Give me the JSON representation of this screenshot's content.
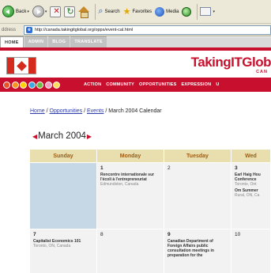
{
  "browser": {
    "back_label": "Back",
    "search_label": "Search",
    "favorites_label": "Favorites",
    "media_label": "Media",
    "address_label": "ddress",
    "url": "http://canada.takingitglobal.org/opps/event-cal.html"
  },
  "site": {
    "tabs": [
      "HOME",
      "ADMIN",
      "BLOG",
      "TRANSLATE"
    ],
    "logo_text": "TakingITGlob",
    "logo_sub": "CAN",
    "nav_links": [
      "ACTION",
      "COMMUNITY",
      "OPPORTUNITIES",
      "EXPRESSION",
      "U"
    ],
    "dot_colors": [
      "#e8532a",
      "#f7941d",
      "#ffd200",
      "#3aa9e0",
      "#6cbd45",
      "#f29fc5",
      "#ffde59"
    ],
    "brand_color": "#c8102e"
  },
  "breadcrumb": {
    "home": "Home",
    "opportunities": "Opportunities",
    "events": "Events",
    "current": "March 2004 Calendar",
    "sep": " / "
  },
  "calendar": {
    "title": "March 2004",
    "prev_arrow": "◀",
    "next_arrow": "▶",
    "weekdays": [
      "Sunday",
      "Monday",
      "Tuesday",
      "Wed"
    ],
    "week1": {
      "monday": {
        "day": "1",
        "event_title": "Rencontre internationale sur l'écoli à l'entrepreneuriat",
        "event_loc": "Edmundston, Canada"
      },
      "tuesday": {
        "day": "2"
      },
      "wednesday": {
        "day": "3",
        "event1_title": "Earl Haig Hou Conference",
        "event1_loc": "Toronto, Ont",
        "event2_title": "Om Summer",
        "event2_loc": "Rural, ON, Ca"
      }
    },
    "week2": {
      "sunday": {
        "day": "7",
        "event_title": "Capitalist Economics 101",
        "event_loc": "Toronto, ON, Canada"
      },
      "monday": {
        "day": "8"
      },
      "tuesday": {
        "day": "9",
        "event_title": "Canadian Department of Foreign Affairs public consultation meetings in preparation for the"
      },
      "wednesday": {
        "day": "10"
      }
    }
  }
}
